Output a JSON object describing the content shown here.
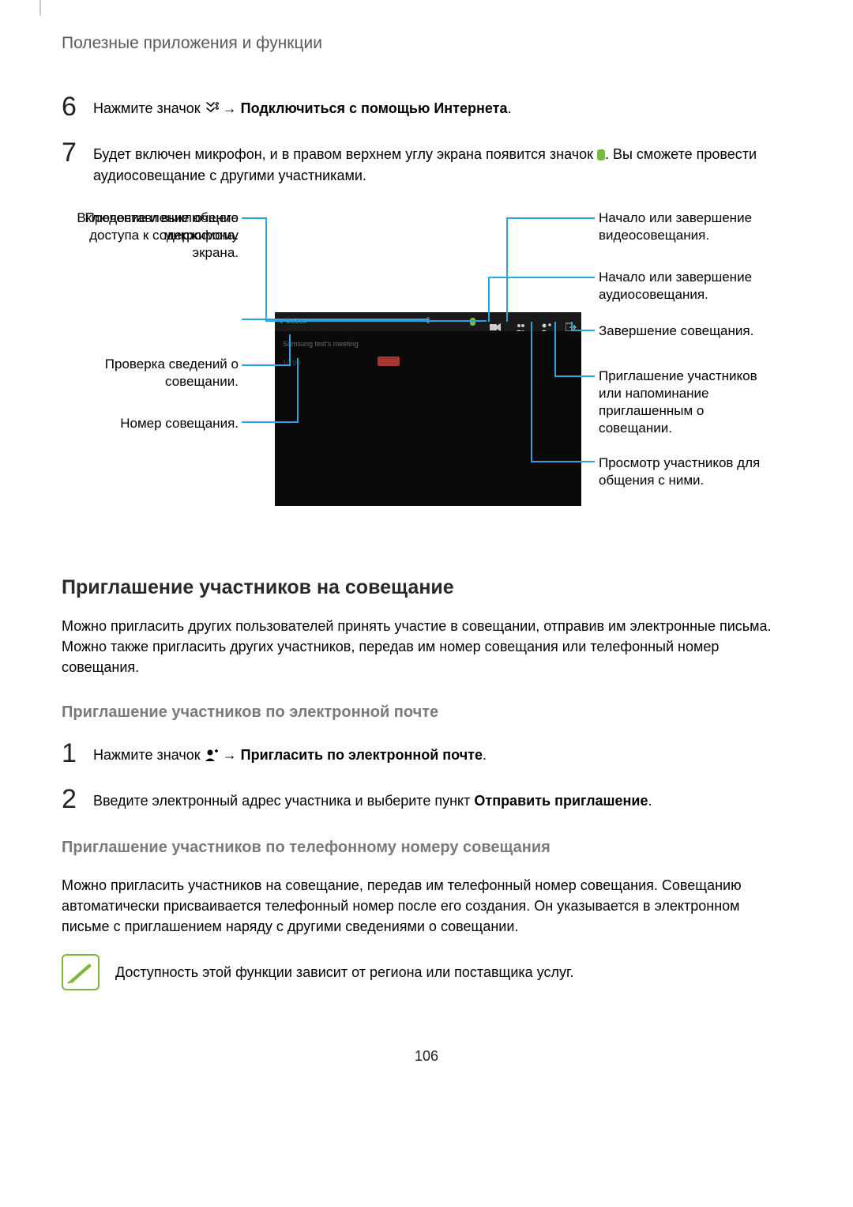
{
  "breadcrumb": "Полезные приложения и функции",
  "step6": {
    "num": "6",
    "pre": "Нажмите значок ",
    "mid": " → ",
    "bold": "Подключиться с помощью Интернета",
    "suffix": "."
  },
  "step7": {
    "num": "7",
    "pre": "Будет включен микрофон, и в правом верхнем углу экрана появится значок ",
    "post": ". Вы сможете провести аудиосовещание с другими участниками."
  },
  "labels_left": {
    "l1": "Включение и выключение микрофона.",
    "l2": "Предоставление общего доступа к содержимому экрана.",
    "l3": "Проверка сведений о совещании.",
    "l4": "Номер совещания."
  },
  "labels_right": {
    "r1": "Начало или завершение видеосовещания.",
    "r2": "Начало или завершение аудиосовещания.",
    "r3": "Завершение совещания.",
    "r4": "Приглашение участников или напоминание приглашенным о совещании.",
    "r5": "Просмотр участников для общения с ними."
  },
  "ss": {
    "back": "‹",
    "webex": "webex",
    "share_sym": "⇪",
    "line1": "Samsung test's meeting",
    "line2": "10:00"
  },
  "section1": {
    "title": "Приглашение участников на совещание",
    "body": "Можно пригласить других пользователей принять участие в совещании, отправив им электронные письма. Можно также пригласить других участников, передав им номер совещания или телефонный номер совещания."
  },
  "sub1": {
    "title": "Приглашение участников по электронной почте"
  },
  "step1b": {
    "num": "1",
    "pre": "Нажмите значок ",
    "mid": " → ",
    "bold": "Пригласить по электронной почте",
    "suffix": "."
  },
  "step2b": {
    "num": "2",
    "pre": "Введите электронный адрес участника и выберите пункт ",
    "bold": "Отправить приглашение",
    "suffix": "."
  },
  "sub2": {
    "title": "Приглашение участников по телефонному номеру совещания",
    "body": "Можно пригласить участников на совещание, передав им телефонный номер совещания. Совещанию автоматически присваивается телефонный номер после его создания. Он указывается в электронном письме с приглашением наряду с другими сведениями о совещании."
  },
  "note": "Доступность этой функции зависит от региона или поставщика услуг.",
  "page_num": "106"
}
